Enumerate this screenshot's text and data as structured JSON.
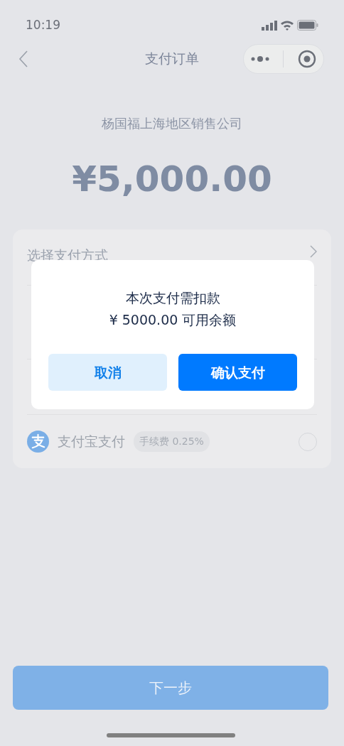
{
  "status_bar": {
    "time": "10:19"
  },
  "nav": {
    "title": "支付订单"
  },
  "payee": "杨国福上海地区销售公司",
  "amount": "¥5,000.00",
  "payment_card": {
    "heading": "选择支付方式",
    "methods": [
      {
        "kind": "alipay",
        "name": "支付宝支付",
        "fee": "手续费 0.25%",
        "selected": false
      }
    ]
  },
  "dialog": {
    "lines": [
      "本次支付需扣款",
      "¥ 5000.00 可用余额"
    ],
    "buttons": [
      {
        "kind": "cancel",
        "label": "取消"
      },
      {
        "kind": "confirm",
        "label": "确认支付"
      }
    ]
  },
  "next_button": {
    "label": "下一步"
  }
}
